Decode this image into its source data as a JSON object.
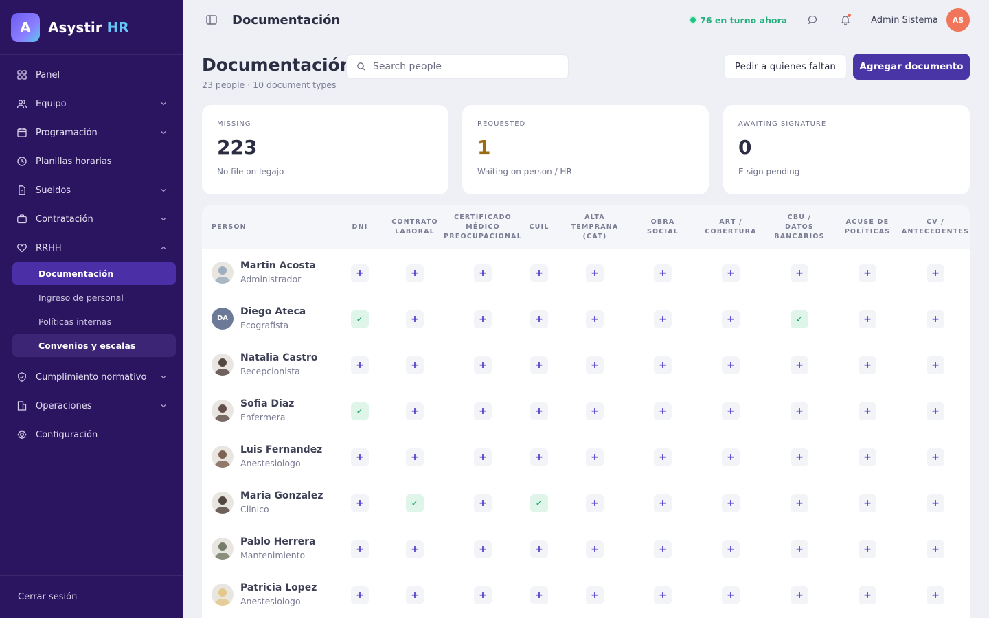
{
  "app": {
    "logo_letter": "A",
    "name": "Asystir",
    "name_accent": "HR"
  },
  "sidebar": {
    "items": [
      {
        "label": "Panel",
        "icon": "grid-icon",
        "chevron": ""
      },
      {
        "label": "Equipo",
        "icon": "users-icon",
        "chevron": "down"
      },
      {
        "label": "Programación",
        "icon": "calendar-icon",
        "chevron": "down"
      },
      {
        "label": "Planillas horarias",
        "icon": "clock-icon",
        "chevron": ""
      },
      {
        "label": "Sueldos",
        "icon": "file-icon",
        "chevron": "down"
      },
      {
        "label": "Contratación",
        "icon": "briefcase-icon",
        "chevron": "down"
      },
      {
        "label": "RRHH",
        "icon": "heart-icon",
        "chevron": "up"
      }
    ],
    "rrhh_sub": [
      "Documentación",
      "Ingreso de personal",
      "Políticas internas",
      "Convenios y escalas"
    ],
    "items_after": [
      {
        "label": "Cumplimiento normativo",
        "icon": "shield-icon",
        "chevron": "down"
      },
      {
        "label": "Operaciones",
        "icon": "building-icon",
        "chevron": "down"
      },
      {
        "label": "Configuración",
        "icon": "gear-icon",
        "chevron": ""
      }
    ],
    "logout": "Cerrar sesión"
  },
  "topbar": {
    "title": "Documentación",
    "shift_text": "76 en turno ahora",
    "user_name": "Admin Sistema",
    "user_initials": "AS"
  },
  "page": {
    "title": "Documentación",
    "subtitle": "23 people · 10 document types",
    "search_placeholder": "Search people",
    "btn_request": "Pedir a quienes faltan",
    "btn_add": "Agregar documento"
  },
  "stats": [
    {
      "label": "MISSING",
      "value": "223",
      "desc": "No file on legajo"
    },
    {
      "label": "REQUESTED",
      "value": "1",
      "desc": "Waiting on person / HR"
    },
    {
      "label": "AWAITING SIGNATURE",
      "value": "0",
      "desc": "E-sign pending"
    }
  ],
  "table": {
    "person_header": "PERSON",
    "columns": [
      "DNI",
      "CONTRATO\nLABORAL",
      "CERTIFICADO\nMÉDICO\nPREOCUPACIONAL",
      "CUIL",
      "ALTA\nTEMPRANA\n(CAT)",
      "OBRA\nSOCIAL",
      "ART /\nCOBERTURA",
      "CBU /\nDATOS\nBANCARIOS",
      "ACUSE DE\nPOLÍTICAS",
      "CV /\nANTECEDENTES"
    ],
    "add_glyph": "+",
    "ok_glyph": "✓",
    "rows": [
      {
        "name": "Martin Acosta",
        "role": "Administrador",
        "avatar": "photo",
        "photo_color": "#8fa4b8",
        "docs": [
          0,
          0,
          0,
          0,
          0,
          0,
          0,
          0,
          0,
          0
        ]
      },
      {
        "name": "Diego Ateca",
        "role": "Ecografista",
        "avatar": "initials",
        "initials": "DA",
        "docs": [
          1,
          0,
          0,
          0,
          0,
          0,
          0,
          1,
          0,
          0
        ]
      },
      {
        "name": "Natalia Castro",
        "role": "Recepcionista",
        "avatar": "photo",
        "photo_color": "#3b2a26",
        "docs": [
          0,
          0,
          0,
          0,
          0,
          0,
          0,
          0,
          0,
          0
        ]
      },
      {
        "name": "Sofia Diaz",
        "role": "Enfermera",
        "avatar": "photo",
        "photo_color": "#4a3430",
        "docs": [
          1,
          0,
          0,
          0,
          0,
          0,
          0,
          0,
          0,
          0
        ]
      },
      {
        "name": "Luis Fernandez",
        "role": "Anestesiologo",
        "avatar": "photo",
        "photo_color": "#6b4a3a",
        "docs": [
          0,
          0,
          0,
          0,
          0,
          0,
          0,
          0,
          0,
          0
        ]
      },
      {
        "name": "Maria Gonzalez",
        "role": "Clinico",
        "avatar": "photo",
        "photo_color": "#3a2a22",
        "docs": [
          0,
          1,
          0,
          1,
          0,
          0,
          0,
          0,
          0,
          0
        ]
      },
      {
        "name": "Pablo Herrera",
        "role": "Mantenimiento",
        "avatar": "photo",
        "photo_color": "#5e6a52",
        "docs": [
          0,
          0,
          0,
          0,
          0,
          0,
          0,
          0,
          0,
          0
        ]
      },
      {
        "name": "Patricia Lopez",
        "role": "Anestesiologo",
        "avatar": "photo",
        "photo_color": "#e2c27a",
        "docs": [
          0,
          0,
          0,
          0,
          0,
          0,
          0,
          0,
          0,
          0
        ]
      }
    ]
  },
  "colors": {
    "sidebar": "#2c1560",
    "accent": "#4a35a6",
    "ok": "#1fa56b",
    "online": "#22c38a",
    "warn": "#9a6b12"
  }
}
